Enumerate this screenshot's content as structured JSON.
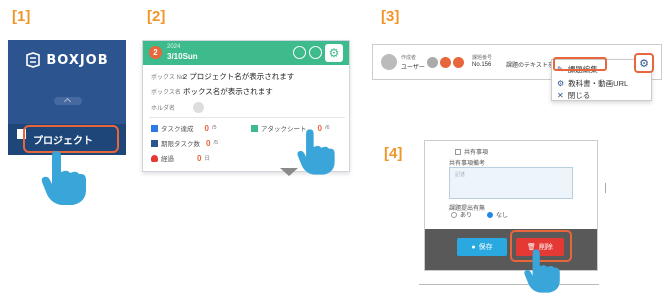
{
  "steps": [
    "[1]",
    "[2]",
    "[3]",
    "[4]"
  ],
  "panel1": {
    "logo_text": "BOXJOB",
    "menu_label": "プロジェクト"
  },
  "panel2": {
    "number": "2",
    "year": "2024",
    "date": "3/10Sun",
    "rows": [
      {
        "key": "ボックス No.",
        "value": "2 プロジェクト名が表示されます"
      },
      {
        "key": "ボックス名",
        "value": "ボックス名が表示されます"
      },
      {
        "key": "ホルダ名",
        "value": ""
      }
    ],
    "stats": [
      {
        "label": "タスク達成",
        "value": "0",
        "unit": "/5"
      },
      {
        "label": "アタックシート",
        "value": "0",
        "unit": "/6"
      },
      {
        "label": "期限タスク数",
        "value": "0",
        "unit": "/5"
      },
      {
        "label": "経過",
        "value": "0",
        "unit": "日"
      }
    ]
  },
  "panel3": {
    "user_caption": "作成者",
    "user_name": "ユーザー",
    "box_caption": "課題番号",
    "box_no": "No.156",
    "task_text": "課題のテキストを",
    "menu_items": [
      {
        "icon": "edit-icon",
        "label": "課題編集"
      },
      {
        "icon": "gear-icon",
        "label": "教科書・動画URL"
      },
      {
        "icon": "close-icon",
        "label": "閉じる"
      }
    ]
  },
  "panel4": {
    "checkbox_label": "共有事項",
    "field_label": "共有事項備考",
    "placeholder": "記述",
    "radio_label": "課題提出有無",
    "radio_options": [
      "あり",
      "なし"
    ],
    "save_label": "保存",
    "delete_label": "削除"
  },
  "colors": {
    "accent": "#f0962a",
    "highlight": "#e8663c",
    "navy": "#2c5590",
    "green": "#3dbb8d",
    "hand": "#3aa5d8",
    "delete": "#e53935",
    "save": "#29a9e0"
  }
}
